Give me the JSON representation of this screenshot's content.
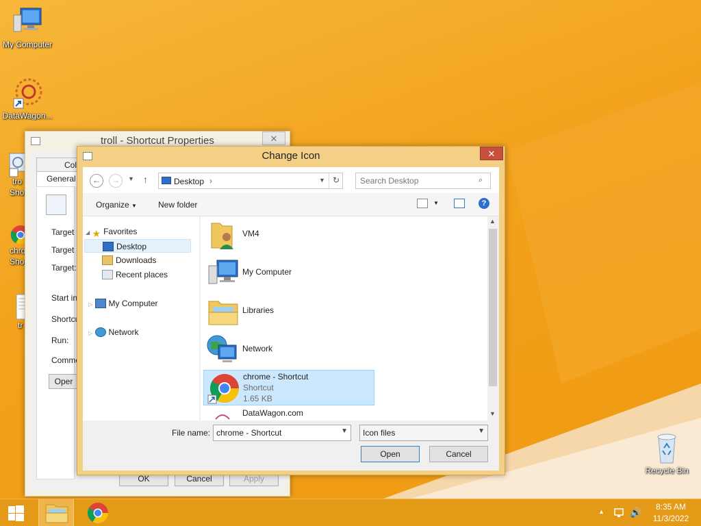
{
  "desktop": {
    "icons": [
      {
        "label": "My Computer"
      },
      {
        "label": "DataWagon..."
      },
      {
        "label": "tro"
      },
      {
        "label": "Sho"
      },
      {
        "label": "chro"
      },
      {
        "label": "Sho"
      },
      {
        "label": "tr"
      },
      {
        "label": "Recycle Bin"
      }
    ]
  },
  "props_window": {
    "title": "troll - Shortcut Properties",
    "tab_colors": "Colo",
    "tab_general": "General",
    "labels": {
      "target_type": "Target ty",
      "target_location": "Target lo",
      "target": "Target:",
      "start_in": "Start in:",
      "shortcut": "Shortcut",
      "run": "Run:",
      "comment": "Commen"
    },
    "open_btn": "Oper",
    "ok": "OK",
    "cancel": "Cancel",
    "apply": "Apply"
  },
  "dialog": {
    "title": "Change Icon",
    "address": {
      "location": "Desktop"
    },
    "search_placeholder": "Search Desktop",
    "organize": "Organize",
    "new_folder": "New folder",
    "nav": {
      "favorites": "Favorites",
      "desktop": "Desktop",
      "downloads": "Downloads",
      "recent": "Recent places",
      "my_computer": "My Computer",
      "network": "Network"
    },
    "files": [
      {
        "name": "VM4"
      },
      {
        "name": "My Computer"
      },
      {
        "name": "Libraries"
      },
      {
        "name": "Network"
      },
      {
        "name": "chrome - Shortcut",
        "type": "Shortcut",
        "size": "1.65 KB"
      },
      {
        "name": "DataWagon.com"
      }
    ],
    "file_name_label": "File name:",
    "file_name_value": "chrome - Shortcut",
    "file_type": "Icon files",
    "open": "Open",
    "cancel": "Cancel"
  },
  "taskbar": {
    "time": "8:35 AM",
    "date": "11/3/2022"
  },
  "colors": {
    "desktop_bg": "#f2a11b",
    "window_frame": "#f4cf86",
    "selection": "#cce8ff",
    "close_red": "#c7503c"
  }
}
